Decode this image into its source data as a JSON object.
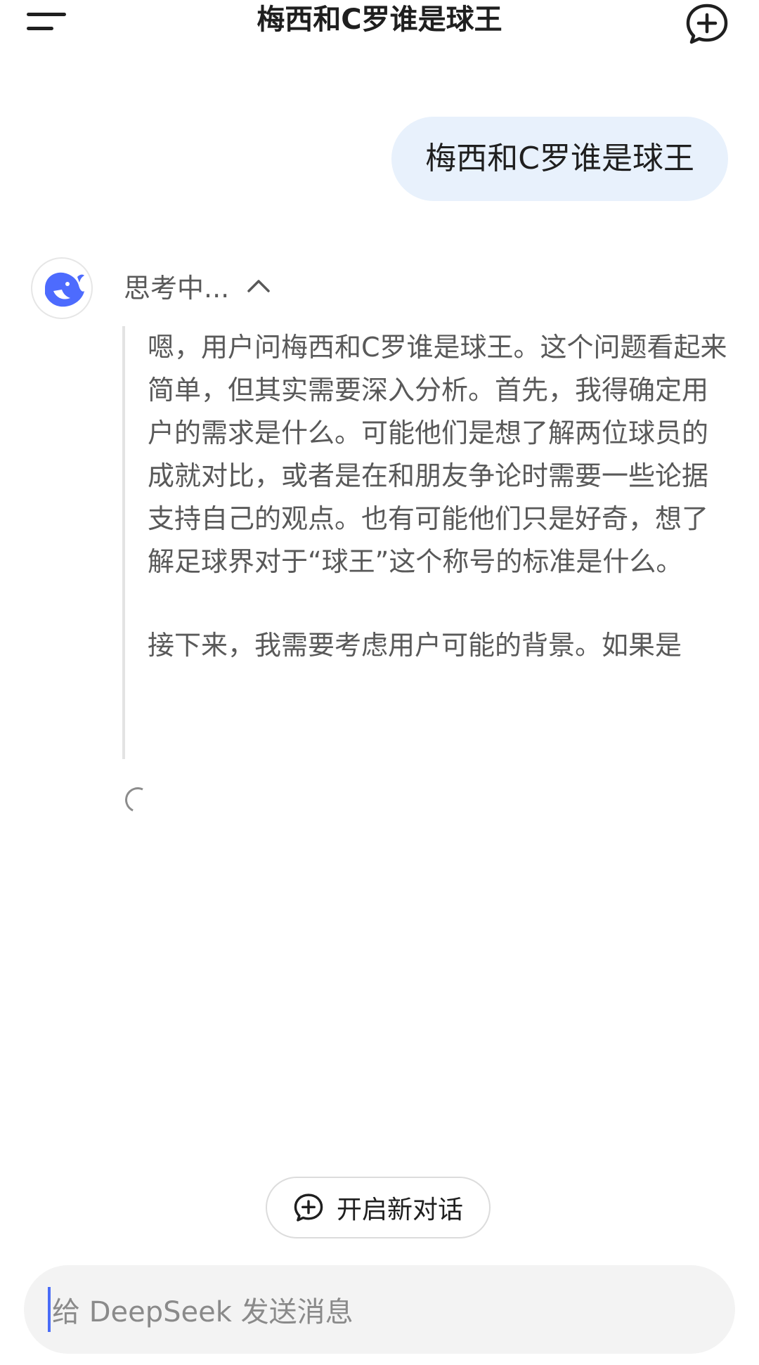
{
  "header": {
    "title": "梅西和C罗谁是球王",
    "menu_icon": "menu-icon",
    "new_chat_icon": "chat-plus-icon"
  },
  "conversation": {
    "user_message": "梅西和C罗谁是球王",
    "assistant": {
      "avatar_icon": "deepseek-whale-icon",
      "thinking_label": "思考中...",
      "thinking_paragraphs": [
        "嗯，用户问梅西和C罗谁是球王。这个问题看起来简单，但其实需要深入分析。首先，我得确定用户的需求是什么。可能他们是想了解两位球员的成就对比，或者是在和朋友争论时需要一些论据支持自己的观点。也有可能他们只是好奇，想了解足球界对于“球王”这个称号的标准是什么。",
        "接下来，我需要考虑用户可能的背景。如果是"
      ]
    }
  },
  "new_conversation_button": {
    "label": "开启新对话",
    "icon": "chat-plus-icon"
  },
  "input": {
    "placeholder": "给 DeepSeek 发送消息"
  },
  "colors": {
    "accent": "#4D6BFE",
    "user_bubble": "#E8F1FC",
    "input_bg": "#F3F3F3"
  }
}
